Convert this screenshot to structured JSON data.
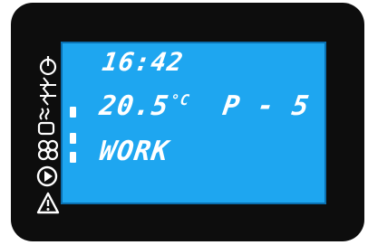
{
  "display": {
    "time": "16:42",
    "temperature": "20.5",
    "temperature_unit": "°C",
    "program": "P - 5",
    "mode": "WORK"
  },
  "icons": [
    "power-icon",
    "heat-element-icon",
    "fan-heater-icon",
    "fan-icon",
    "play-icon",
    "warning-icon"
  ],
  "colors": {
    "bezel": "#0d0d0d",
    "lcd": "#1ea6f0",
    "segment": "#ffffff"
  }
}
